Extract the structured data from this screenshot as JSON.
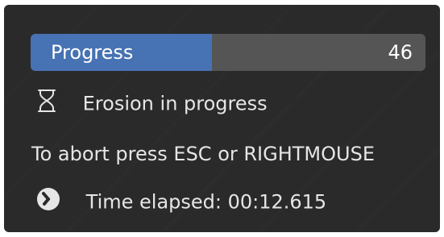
{
  "progress": {
    "label": "Progress",
    "value": "46",
    "fraction": 0.46
  },
  "status": {
    "icon": "hourglass-icon",
    "text": "Erosion in progress"
  },
  "abort_hint": "To abort press ESC or RIGHTMOUSE",
  "timer": {
    "icon": "clock-icon",
    "text": "Time elapsed: 00:12.615"
  },
  "colors": {
    "panel_bg": "#2a2a2a",
    "progress_fill": "#4772b3",
    "progress_track": "#555555",
    "text": "#e6e6e6"
  }
}
